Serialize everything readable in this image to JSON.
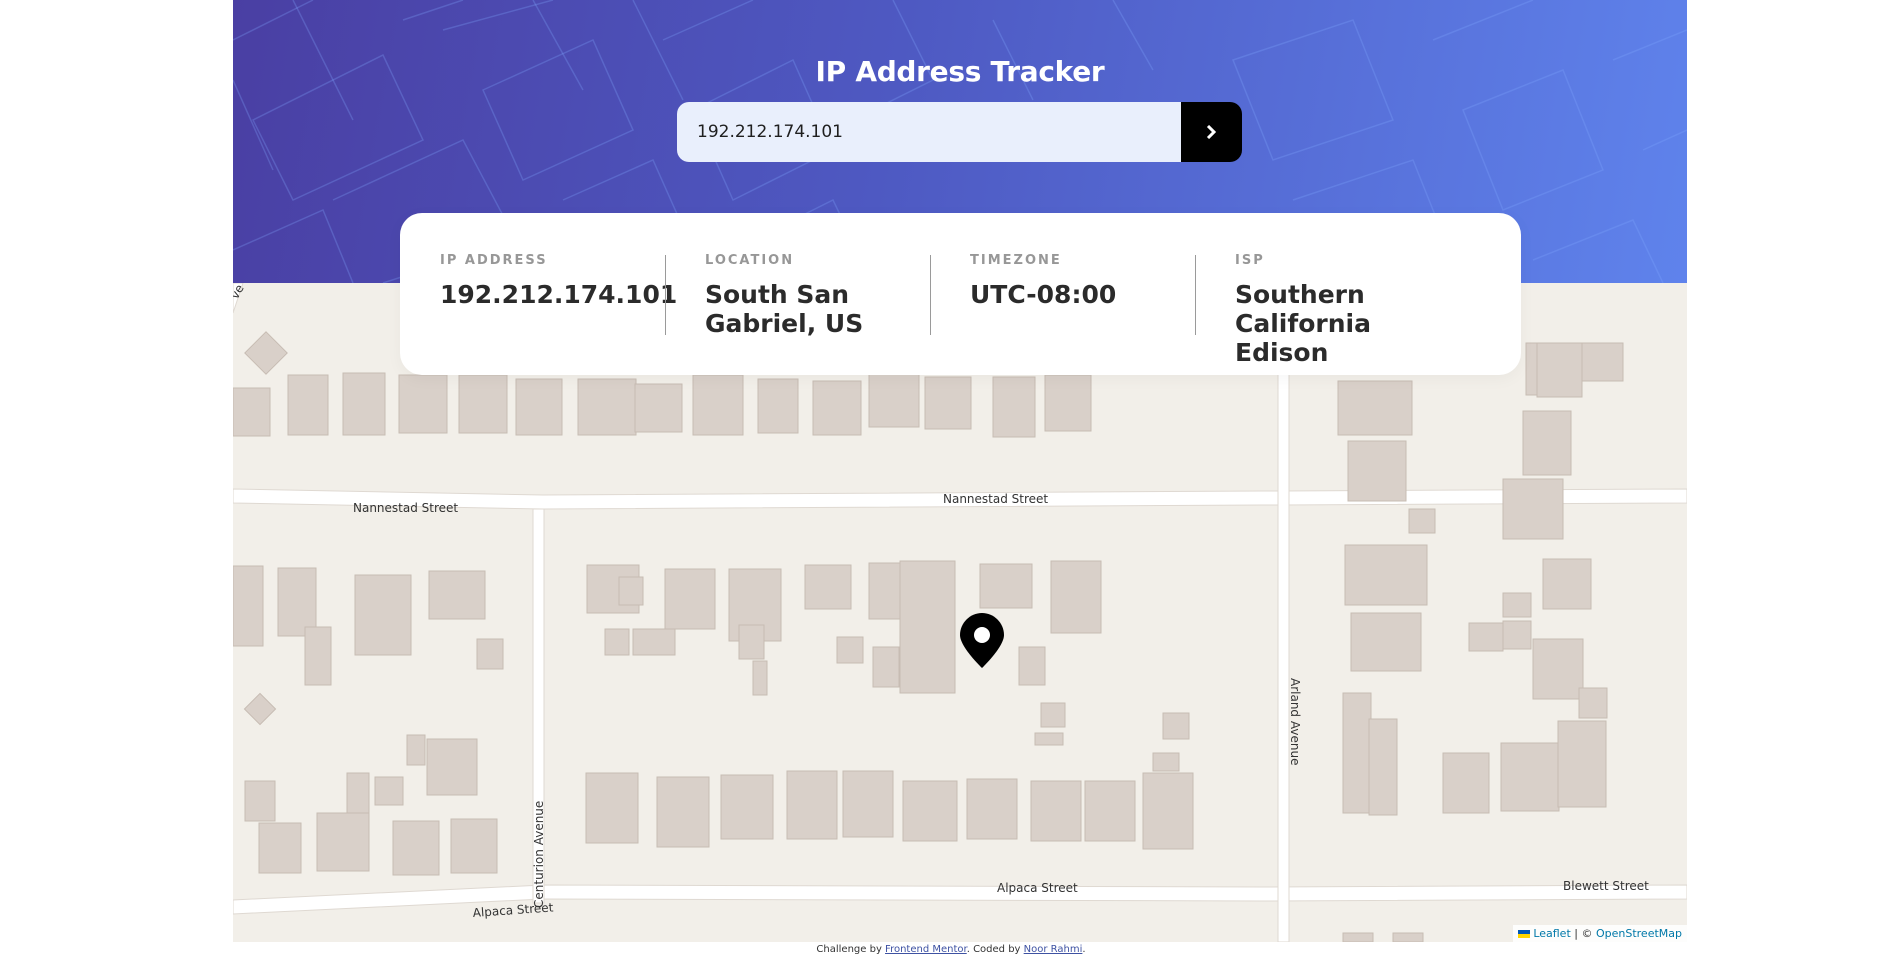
{
  "header": {
    "title": "IP Address Tracker"
  },
  "search": {
    "value": "192.212.174.101",
    "button_icon": "chevron-right-icon"
  },
  "info": [
    {
      "label": "IP ADDRESS",
      "value": "192.212.174.101"
    },
    {
      "label": "LOCATION",
      "value": "South San Gabriel, US"
    },
    {
      "label": "TIMEZONE",
      "value": "UTC-08:00"
    },
    {
      "label": "ISP",
      "value": "Southern California Edison"
    }
  ],
  "map": {
    "streets": {
      "nannestad_west": "Nannestad Street",
      "nannestad_east": "Nannestad Street",
      "centurion": "Centurion Avenue",
      "arland": "Arland Avenue",
      "alpaca_west": "Alpaca Street",
      "alpaca_east": "Alpaca Street",
      "blewett": "Blewett Street",
      "partial": "ve"
    },
    "marker_icon": "location-pin-icon",
    "attribution": {
      "leaflet": "Leaflet",
      "separator": " | © ",
      "osm": "OpenStreetMap"
    }
  },
  "footer": {
    "prefix": "Challenge by ",
    "challenge_link": "Frontend Mentor",
    "middle": ". Coded by ",
    "author_link": "Noor Rahmi",
    "suffix": "."
  },
  "colors": {
    "gradient_start": "#4a3fa3",
    "gradient_end": "#5f83ec",
    "map_background": "#f2efe9",
    "building": "#d9d0c9",
    "card": "#ffffff"
  }
}
